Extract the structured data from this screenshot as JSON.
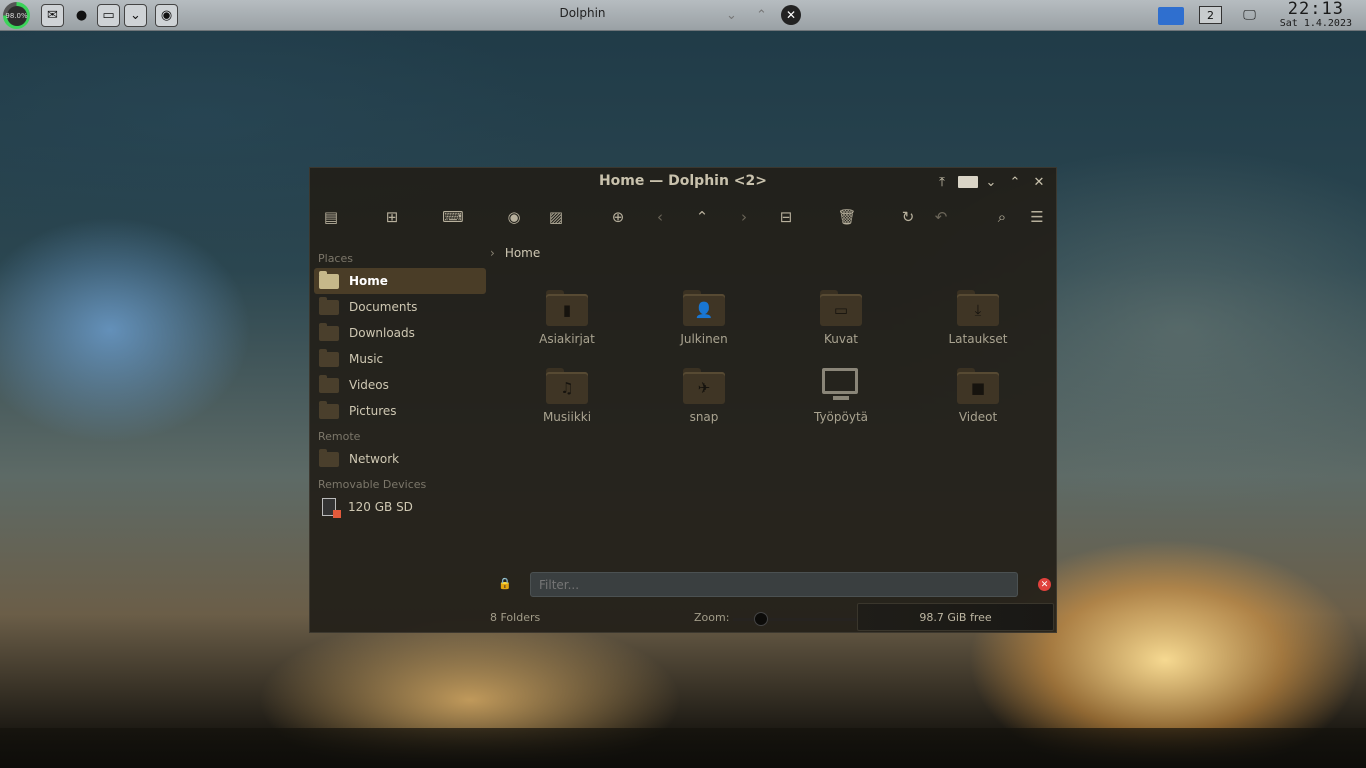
{
  "panel": {
    "cpu_label": "98.0%",
    "window_title": "Dolphin",
    "desktop_number": "2",
    "time": "22:13",
    "date": "Sat 1.4.2023"
  },
  "window": {
    "title": "Home — Dolphin <2>",
    "sidebar": {
      "sections": [
        {
          "label": "Places"
        },
        {
          "label": "Remote"
        },
        {
          "label": "Removable Devices"
        }
      ],
      "places": [
        "Home",
        "Documents",
        "Downloads",
        "Music",
        "Videos",
        "Pictures"
      ],
      "remote": [
        "Network"
      ],
      "devices": [
        "120 GB SD"
      ]
    },
    "breadcrumb": "Home",
    "items": [
      {
        "name": "Asiakirjat",
        "glyph": "▮"
      },
      {
        "name": "Julkinen",
        "glyph": "👤"
      },
      {
        "name": "Kuvat",
        "glyph": "▭"
      },
      {
        "name": "Lataukset",
        "glyph": "⤓"
      },
      {
        "name": "Musiikki",
        "glyph": "♫"
      },
      {
        "name": "snap",
        "glyph": "✈"
      },
      {
        "name": "Työpöytä",
        "glyph": ""
      },
      {
        "name": "Videot",
        "glyph": "■"
      }
    ],
    "filter_placeholder": "Filter...",
    "status": {
      "count": "8 Folders",
      "zoom_label": "Zoom:",
      "free": "98.7 GiB free"
    }
  },
  "colors": {
    "accent": "#4a3d27",
    "selected_folder": "#c6b88a",
    "close_red": "#e0413c"
  }
}
